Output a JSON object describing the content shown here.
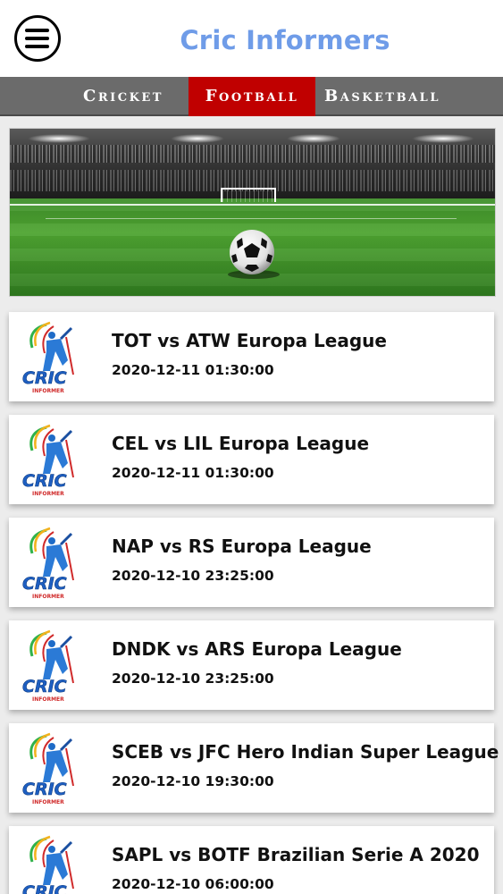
{
  "header": {
    "title": "Cric Informers",
    "menu_icon": "hamburger-menu-icon"
  },
  "tabs": [
    {
      "label": "Cricket",
      "active": false
    },
    {
      "label": "Football",
      "active": true
    },
    {
      "label": "Basketball",
      "active": false
    }
  ],
  "colors": {
    "title": "#6f9ce8",
    "active_tab": "#c00000",
    "tab_bar": "#6b6b6b"
  },
  "banner": {
    "image": "football-stadium-banner"
  },
  "matches": [
    {
      "title": "TOT vs ATW Europa League",
      "time": "2020-12-11 01:30:00"
    },
    {
      "title": "CEL vs LIL Europa League",
      "time": "2020-12-11 01:30:00"
    },
    {
      "title": "NAP vs RS Europa League",
      "time": "2020-12-10 23:25:00"
    },
    {
      "title": "DNDK vs ARS Europa League",
      "time": "2020-12-10 23:25:00"
    },
    {
      "title": "SCEB vs JFC Hero Indian Super League",
      "time": "2020-12-10 19:30:00"
    },
    {
      "title": "SAPL vs BOTF Brazilian Serie A 2020",
      "time": "2020-12-10 06:00:00"
    }
  ],
  "logo": {
    "text": "CRIC",
    "subtext": "INFORMER"
  }
}
